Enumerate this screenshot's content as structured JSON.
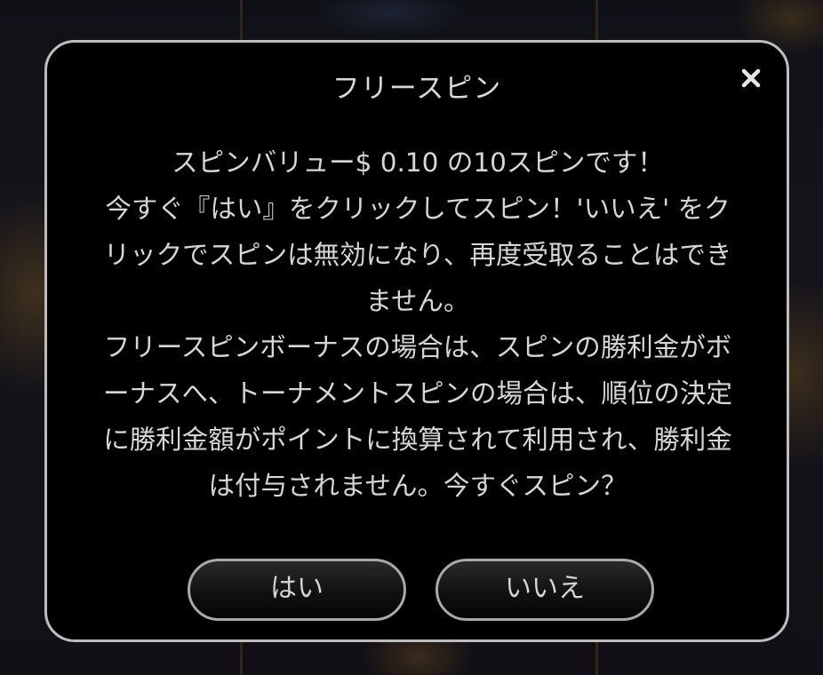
{
  "dialog": {
    "title": "フリースピン",
    "close_icon": "close-icon",
    "message_lines": [
      "スピンバリュー$ 0.10 の10スピンです！",
      "今すぐ『はい』をクリックしてスピン！'いいえ' をク",
      "リックでスピンは無効になり、再度受取ることはでき",
      "ません。",
      "フリースピンボーナスの場合は、スピンの勝利金がボ",
      "ーナスへ、トーナメントスピンの場合は、順位の決定",
      "に勝利金額がポイントに換算されて利用され、勝利金",
      "は付与されません。今すぐスピン？"
    ],
    "yes_label": "はい",
    "no_label": "いいえ"
  },
  "colors": {
    "dialog_background": "#000000",
    "dialog_border": "#bdbdbd",
    "text": "#d6d6d6",
    "button_border": "#a9a9a9"
  }
}
